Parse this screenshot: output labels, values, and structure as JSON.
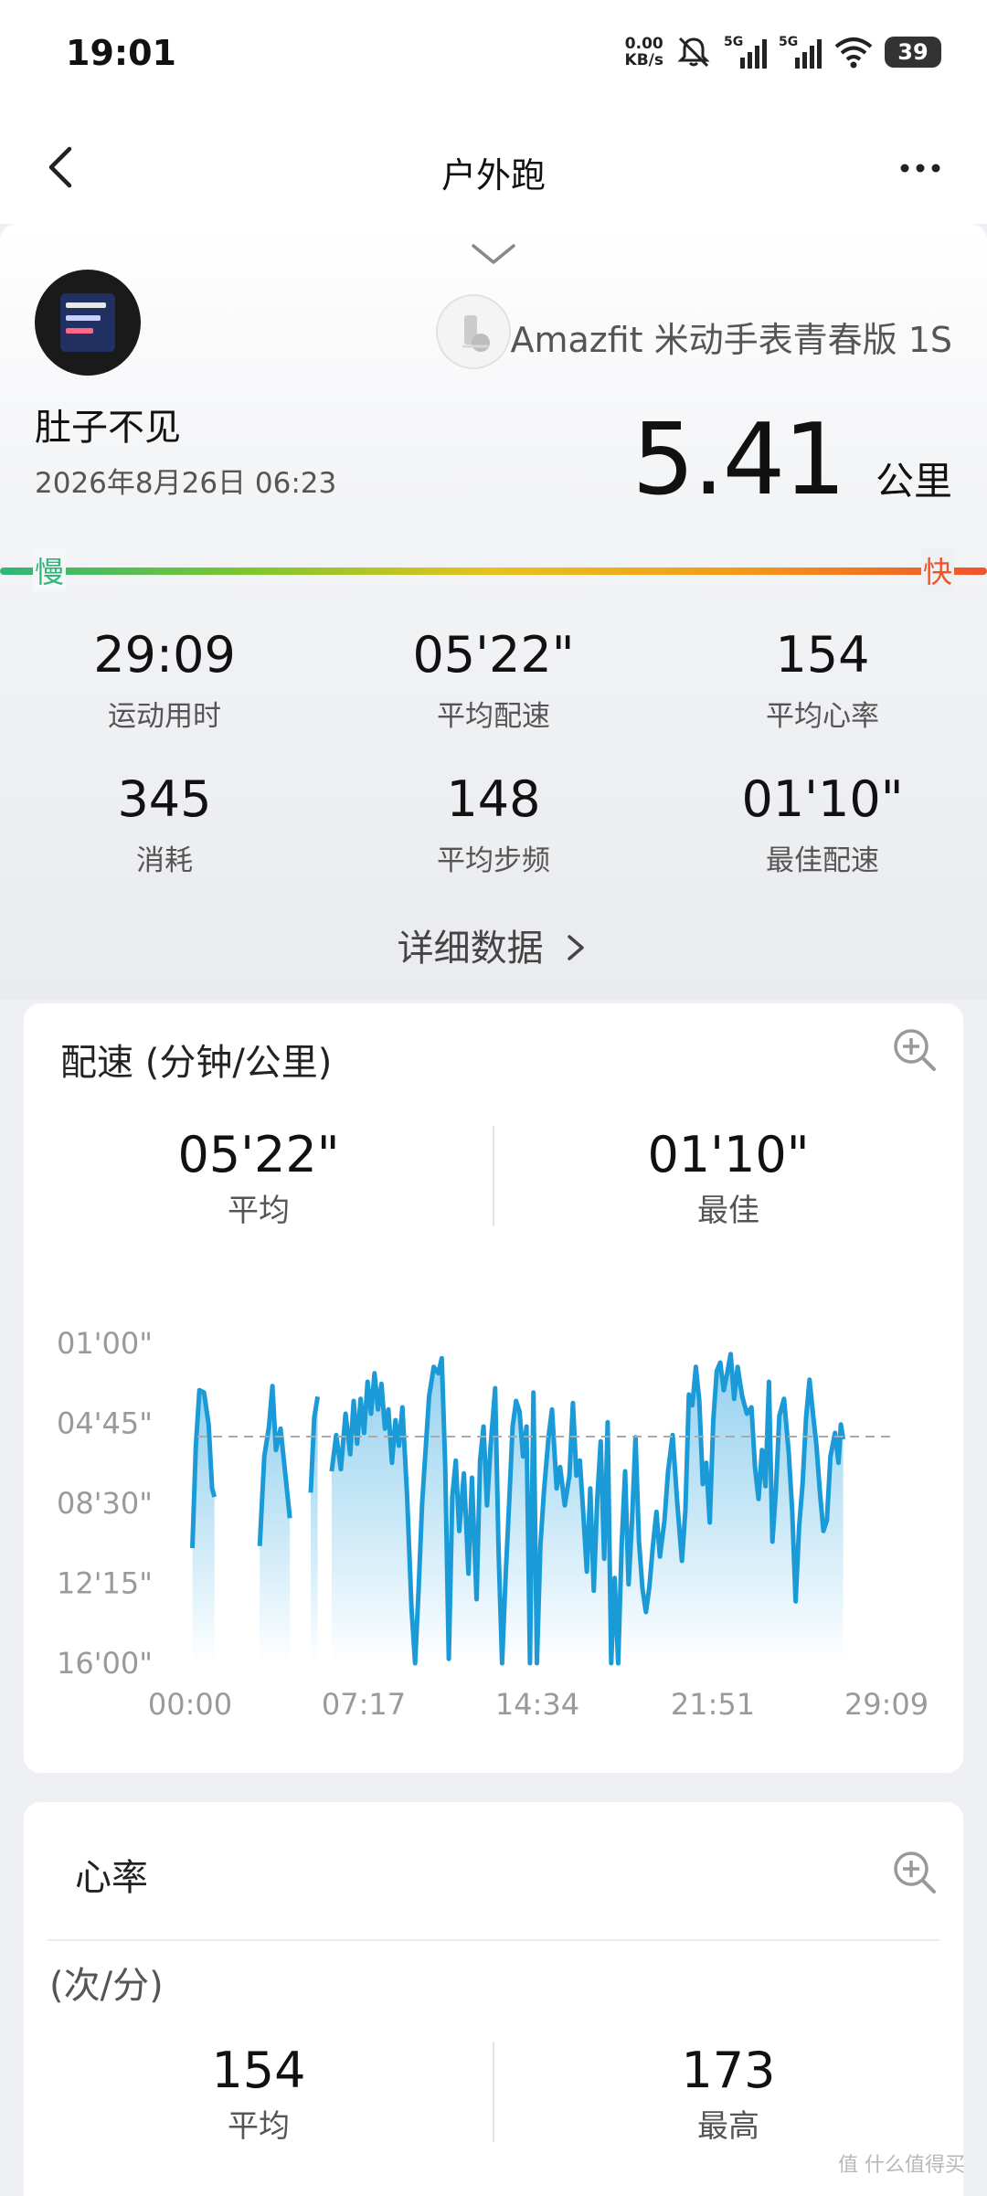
{
  "status_bar": {
    "time": "19:01",
    "net_speed_value": "0.00",
    "net_speed_unit": "KB/s",
    "signal_1_label": "5G",
    "signal_2_label": "5G",
    "battery": "39",
    "icons": [
      "mute-icon",
      "signal-icon",
      "signal-icon",
      "wifi-icon",
      "battery-icon"
    ]
  },
  "nav": {
    "title": "户外跑",
    "back_icon": "chevron-left-icon",
    "more_icon": "more-horizontal-icon"
  },
  "summary": {
    "user_name": "肚子不见",
    "date": "2026年8月26日 06:23",
    "device_name": "Amazfit 米动手表青春版 1S",
    "distance": "5.41",
    "distance_unit": "公里",
    "slow_label": "慢",
    "fast_label": "快",
    "stats": [
      {
        "value": "29:09",
        "label": "运动用时"
      },
      {
        "value": "05'22\"",
        "label": "平均配速"
      },
      {
        "value": "154",
        "label": "平均心率"
      },
      {
        "value": "345",
        "label": "消耗"
      },
      {
        "value": "148",
        "label": "平均步频"
      },
      {
        "value": "01'10\"",
        "label": "最佳配速"
      }
    ],
    "details_link": "详细数据"
  },
  "pace_card": {
    "title": "配速 (分钟/公里)",
    "avg_value": "05'22\"",
    "avg_label": "平均",
    "best_value": "01'10\"",
    "best_label": "最佳"
  },
  "chart_data": {
    "type": "area",
    "x_tick_labels": [
      "00:00",
      "07:17",
      "14:34",
      "21:51",
      "29:09"
    ],
    "y_tick_labels": [
      "01'00\"",
      "04'45\"",
      "08'30\"",
      "12'15\"",
      "16'00\""
    ],
    "y_ticks_min": [
      1,
      4.75,
      8.5,
      12.25,
      16
    ],
    "ylim_min_per_km": [
      1,
      16
    ],
    "y_axis_inverted": true,
    "xlim_min": [
      0,
      29.15
    ],
    "average_line_min_per_km": 5.37,
    "colors": {
      "line": "#1a9bd7",
      "fill_top": "#7fc8ec",
      "fill_bottom": "#ffffff",
      "avg_line": "#aaaaaa"
    },
    "segments": [
      [
        [
          0.1,
          10.6
        ],
        [
          0.25,
          5.8
        ],
        [
          0.4,
          3.2
        ],
        [
          0.6,
          3.3
        ],
        [
          0.8,
          4.8
        ],
        [
          0.95,
          7.8
        ],
        [
          1.05,
          8.2
        ]
      ],
      [
        [
          3.0,
          10.5
        ],
        [
          3.2,
          6.3
        ],
        [
          3.4,
          4.9
        ],
        [
          3.55,
          3.0
        ],
        [
          3.7,
          6.0
        ],
        [
          3.9,
          5.0
        ],
        [
          4.1,
          7.1
        ],
        [
          4.3,
          9.2
        ]
      ],
      [
        [
          5.2,
          8.0
        ],
        [
          5.35,
          4.5
        ],
        [
          5.5,
          3.5
        ]
      ],
      [
        [
          6.1,
          7.0
        ],
        [
          6.3,
          5.3
        ],
        [
          6.5,
          6.9
        ],
        [
          6.7,
          4.3
        ],
        [
          6.9,
          6.2
        ],
        [
          7.05,
          3.7
        ],
        [
          7.2,
          5.7
        ],
        [
          7.35,
          3.6
        ],
        [
          7.5,
          5.2
        ],
        [
          7.65,
          2.8
        ],
        [
          7.8,
          4.3
        ],
        [
          7.95,
          2.4
        ],
        [
          8.1,
          4.1
        ],
        [
          8.25,
          2.9
        ],
        [
          8.4,
          5.0
        ],
        [
          8.55,
          4.1
        ],
        [
          8.7,
          6.6
        ],
        [
          8.85,
          4.6
        ],
        [
          9.0,
          5.8
        ],
        [
          9.15,
          4.0
        ],
        [
          9.35,
          8.1
        ],
        [
          9.55,
          13.5
        ],
        [
          9.7,
          16.0
        ],
        [
          9.85,
          12.5
        ],
        [
          10.0,
          8.5
        ],
        [
          10.15,
          6.0
        ],
        [
          10.3,
          3.5
        ],
        [
          10.5,
          2.1
        ],
        [
          10.7,
          2.4
        ],
        [
          10.85,
          1.7
        ],
        [
          11.0,
          6.8
        ],
        [
          11.15,
          15.8
        ],
        [
          11.3,
          8.2
        ],
        [
          11.45,
          6.5
        ],
        [
          11.6,
          9.8
        ],
        [
          11.8,
          7.1
        ],
        [
          12.0,
          11.8
        ],
        [
          12.15,
          7.3
        ],
        [
          12.35,
          13.0
        ],
        [
          12.5,
          6.5
        ],
        [
          12.65,
          4.9
        ],
        [
          12.8,
          8.6
        ],
        [
          12.95,
          5.9
        ],
        [
          13.15,
          3.1
        ],
        [
          13.3,
          10.8
        ],
        [
          13.45,
          16.0
        ],
        [
          13.6,
          12.0
        ],
        [
          13.75,
          8.5
        ],
        [
          13.9,
          4.9
        ],
        [
          14.05,
          3.7
        ],
        [
          14.2,
          4.2
        ],
        [
          14.35,
          6.3
        ],
        [
          14.5,
          4.9
        ],
        [
          14.65,
          16.0
        ],
        [
          14.8,
          3.3
        ],
        [
          14.95,
          16.0
        ],
        [
          15.1,
          10.5
        ],
        [
          15.25,
          8.0
        ],
        [
          15.45,
          5.4
        ],
        [
          15.6,
          4.1
        ],
        [
          15.8,
          7.8
        ],
        [
          15.95,
          6.8
        ],
        [
          16.15,
          8.6
        ],
        [
          16.35,
          7.2
        ],
        [
          16.5,
          3.8
        ],
        [
          16.65,
          7.2
        ],
        [
          16.8,
          6.5
        ],
        [
          16.95,
          9.0
        ],
        [
          17.1,
          11.7
        ],
        [
          17.25,
          7.8
        ],
        [
          17.4,
          12.6
        ],
        [
          17.55,
          8.3
        ],
        [
          17.7,
          5.6
        ],
        [
          17.85,
          11.1
        ],
        [
          18.0,
          4.7
        ],
        [
          18.15,
          16.0
        ],
        [
          18.3,
          12.0
        ],
        [
          18.45,
          16.0
        ],
        [
          18.6,
          10.5
        ],
        [
          18.75,
          7.0
        ],
        [
          18.9,
          12.3
        ],
        [
          19.05,
          9.3
        ],
        [
          19.2,
          5.4
        ],
        [
          19.35,
          10.3
        ],
        [
          19.5,
          12.5
        ],
        [
          19.65,
          13.6
        ],
        [
          19.8,
          12.4
        ],
        [
          19.95,
          10.5
        ],
        [
          20.1,
          8.9
        ],
        [
          20.25,
          11.0
        ],
        [
          20.45,
          9.3
        ],
        [
          20.6,
          7.0
        ],
        [
          20.8,
          5.3
        ],
        [
          21.0,
          8.5
        ],
        [
          21.2,
          11.2
        ],
        [
          21.35,
          8.8
        ],
        [
          21.5,
          3.4
        ],
        [
          21.65,
          3.9
        ],
        [
          21.8,
          2.1
        ],
        [
          21.95,
          3.7
        ],
        [
          22.1,
          7.6
        ],
        [
          22.25,
          6.6
        ],
        [
          22.4,
          9.4
        ],
        [
          22.55,
          4.6
        ],
        [
          22.7,
          2.3
        ],
        [
          22.85,
          1.9
        ],
        [
          23.0,
          3.2
        ],
        [
          23.15,
          2.4
        ],
        [
          23.3,
          1.5
        ],
        [
          23.45,
          3.6
        ],
        [
          23.6,
          2.1
        ],
        [
          23.8,
          3.5
        ],
        [
          24.0,
          4.3
        ],
        [
          24.2,
          4.0
        ],
        [
          24.35,
          6.8
        ],
        [
          24.5,
          8.3
        ],
        [
          24.65,
          6.0
        ],
        [
          24.8,
          7.7
        ],
        [
          24.95,
          2.8
        ],
        [
          25.1,
          10.3
        ],
        [
          25.25,
          7.9
        ],
        [
          25.4,
          4.4
        ],
        [
          25.6,
          3.6
        ],
        [
          25.8,
          6.1
        ],
        [
          25.95,
          8.8
        ],
        [
          26.1,
          13.1
        ],
        [
          26.25,
          9.6
        ],
        [
          26.4,
          7.6
        ],
        [
          26.55,
          4.5
        ],
        [
          26.7,
          2.7
        ],
        [
          26.85,
          4.3
        ],
        [
          27.0,
          5.8
        ],
        [
          27.15,
          8.0
        ],
        [
          27.3,
          9.8
        ],
        [
          27.45,
          9.3
        ],
        [
          27.6,
          6.3
        ],
        [
          27.8,
          5.2
        ],
        [
          27.95,
          6.6
        ],
        [
          28.05,
          4.8
        ],
        [
          28.15,
          5.5
        ]
      ]
    ]
  },
  "hr_card": {
    "title": "心率",
    "unit": "(次/分)",
    "avg_value": "154",
    "avg_label": "平均",
    "max_value": "173",
    "max_label": "最高"
  },
  "watermark": "值 什么值得买"
}
